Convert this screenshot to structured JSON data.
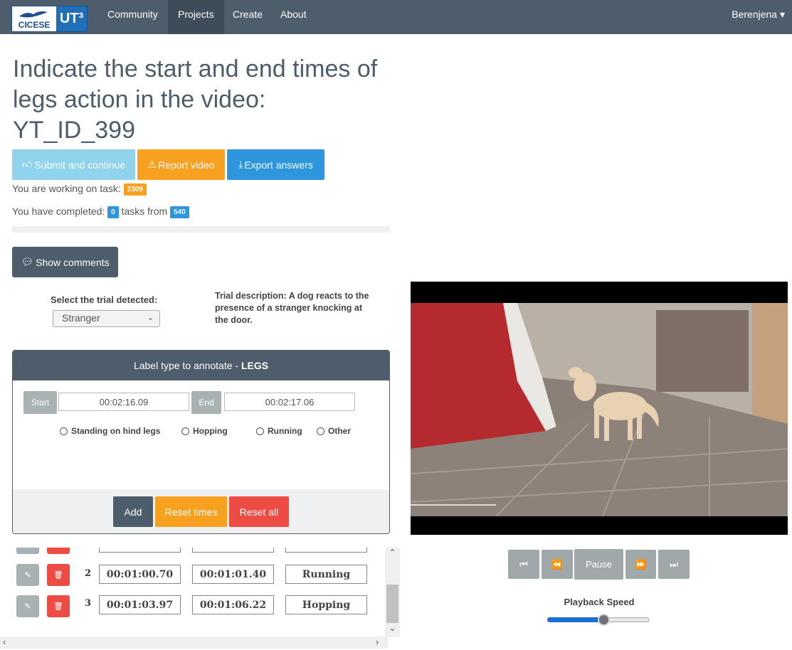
{
  "navbar": {
    "logo_text": "CICESE",
    "logo_mark": "UT³",
    "items": [
      {
        "label": "Community"
      },
      {
        "label": "Projects"
      },
      {
        "label": "Create"
      },
      {
        "label": "About"
      }
    ],
    "user": "Berenjena ▾"
  },
  "title": {
    "line1": "Indicate the start and end times of",
    "line2": "legs action in the video:",
    "line3": "YT_ID_399"
  },
  "actions": {
    "submit": "Submit and continue",
    "report": "Report video",
    "export": "Export answers"
  },
  "status": {
    "working_prefix": "You are working on task:",
    "task_id": "2309",
    "completed_prefix": "You have completed:",
    "completed_count": "0",
    "tasks_from": "tasks from",
    "total": "540"
  },
  "comments_button": "Show comments",
  "trial": {
    "select_label": "Select the trial detected:",
    "selected": "Stranger",
    "description": "Trial description: A dog reacts to the presence of a stranger knocking at the door."
  },
  "panel": {
    "heading_prefix": "Label type to annotate - ",
    "heading_type": "LEGS",
    "start_label": "Start",
    "start_value": "00:02:16.09",
    "end_label": "End",
    "end_value": "00:02:17.06",
    "options": [
      "Standing on hind legs",
      "Hopping",
      "Running",
      "Other"
    ],
    "add": "Add",
    "reset_times": "Reset times",
    "reset_all": "Reset all"
  },
  "annotations": [
    {
      "index": "2",
      "start": "00:01:00.70",
      "end": "00:01:01.40",
      "label": "Running"
    },
    {
      "index": "3",
      "start": "00:01:03.97",
      "end": "00:01:06.22",
      "label": "Hopping"
    }
  ],
  "player": {
    "pause": "Pause",
    "speed_label": "Playback Speed",
    "speed_fraction": 0.55
  },
  "colors": {
    "navbar": "#4e5d6c",
    "info": "#8fd3ec",
    "warning": "#f8a01f",
    "primary": "#2e96dd",
    "danger": "#ec4c43"
  }
}
